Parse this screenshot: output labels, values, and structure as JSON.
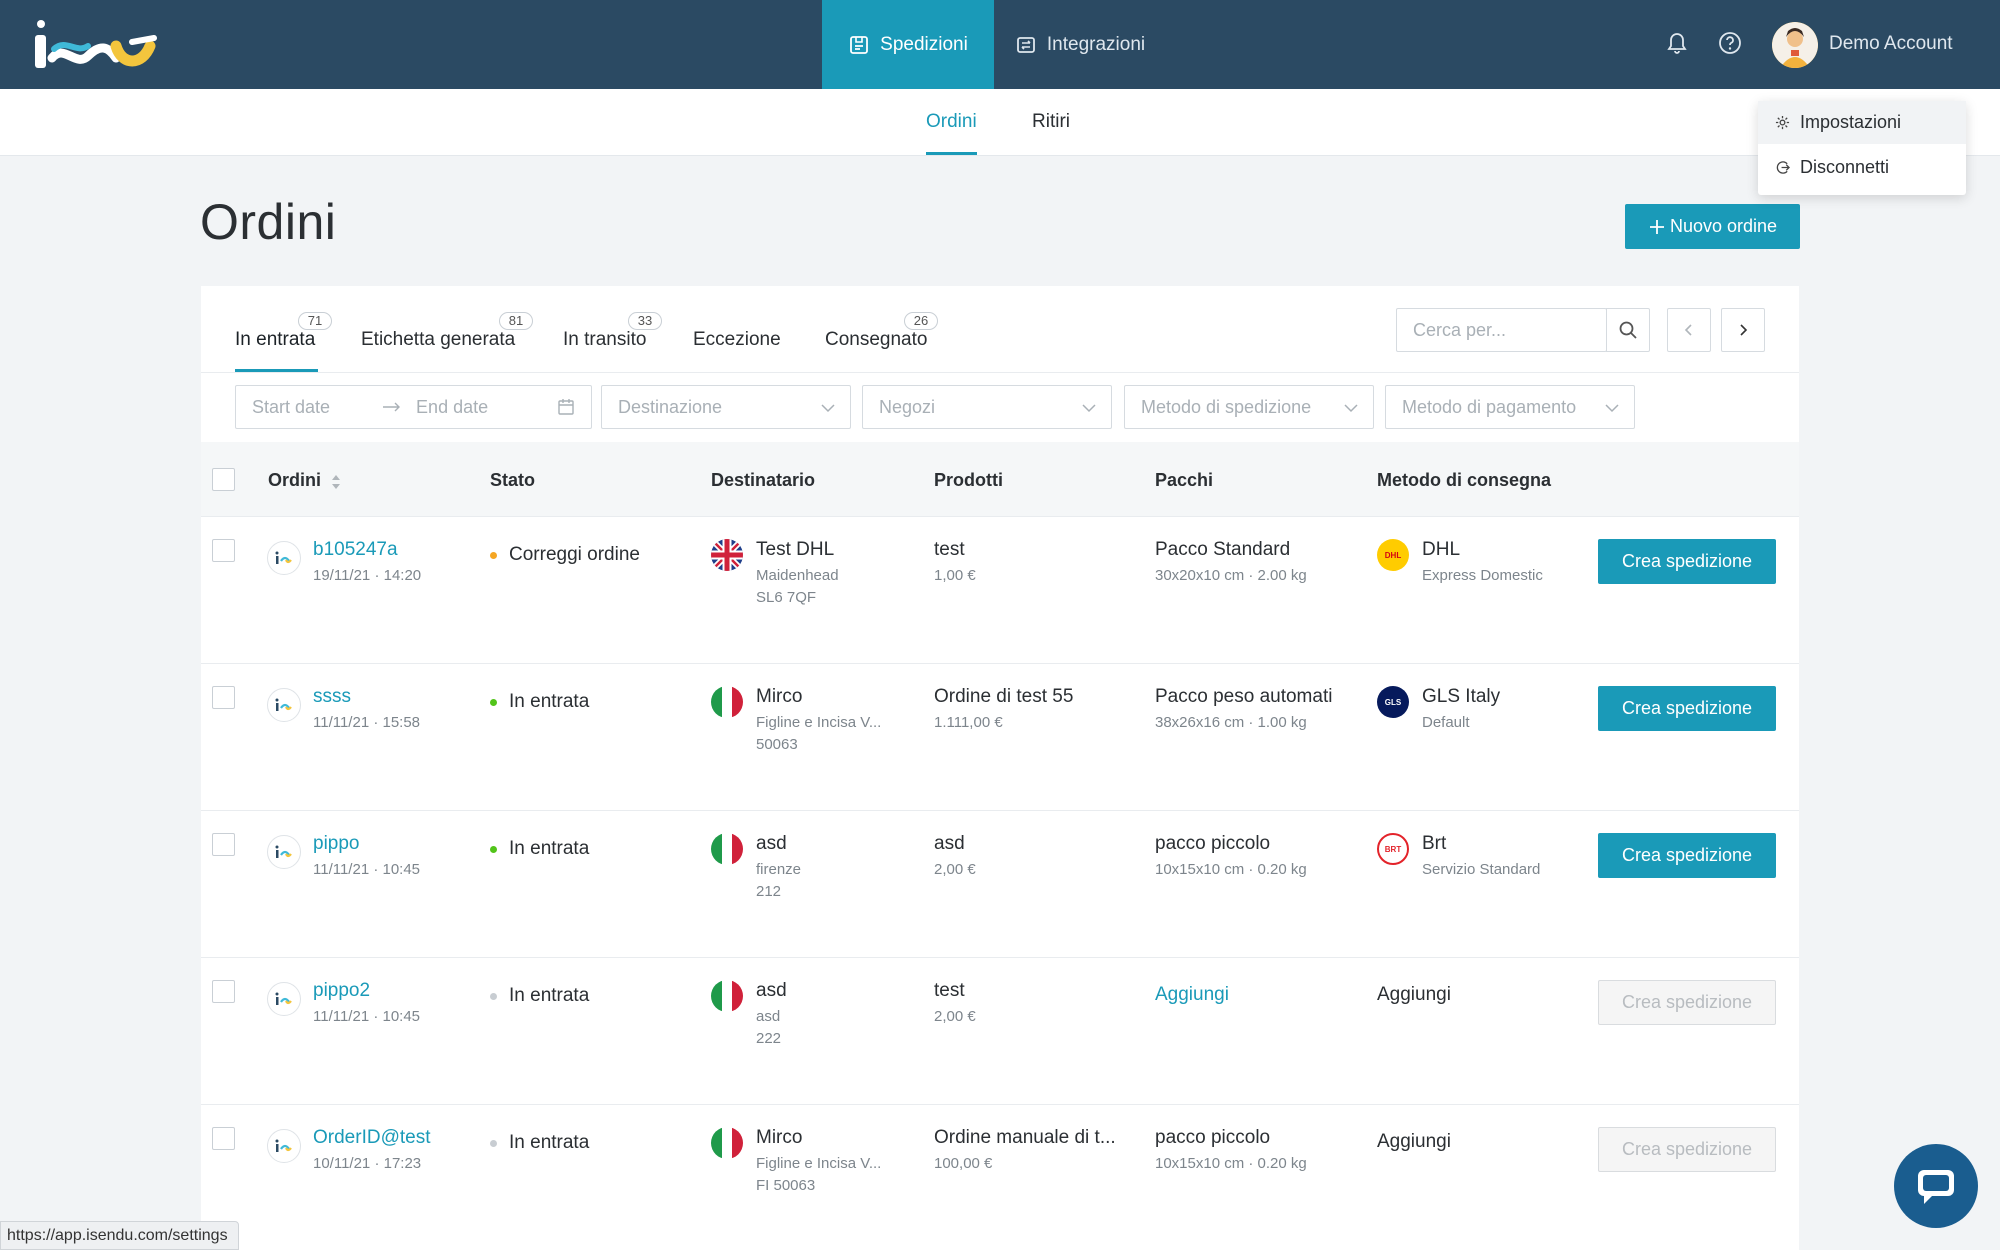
{
  "topbar": {
    "nav": [
      {
        "label": "Spedizioni",
        "icon": "shipment-icon",
        "active": true
      },
      {
        "label": "Integrazioni",
        "icon": "integration-icon",
        "active": false
      }
    ],
    "account_name": "Demo Account"
  },
  "subnav": {
    "tabs": [
      {
        "label": "Ordini",
        "active": true
      },
      {
        "label": "Ritiri",
        "active": false
      }
    ]
  },
  "user_menu": {
    "items": [
      {
        "label": "Impostazioni",
        "icon": "gear-icon"
      },
      {
        "label": "Disconnetti",
        "icon": "logout-icon"
      }
    ]
  },
  "page": {
    "title": "Ordini",
    "new_order_label": "Nuovo ordine"
  },
  "status_tabs": [
    {
      "label": "In entrata",
      "count": "71",
      "active": true
    },
    {
      "label": "Etichetta generata",
      "count": "81",
      "active": false
    },
    {
      "label": "In transito",
      "count": "33",
      "active": false
    },
    {
      "label": "Eccezione",
      "count": "",
      "active": false
    },
    {
      "label": "Consegnato",
      "count": "26",
      "active": false
    }
  ],
  "search": {
    "placeholder": "Cerca per..."
  },
  "filters": {
    "start_date": "Start date",
    "end_date": "End date",
    "destinazione": "Destinazione",
    "negozi": "Negozi",
    "metodo_spedizione": "Metodo di spedizione",
    "metodo_pagamento": "Metodo di pagamento"
  },
  "table": {
    "headers": [
      "Ordini",
      "Stato",
      "Destinatario",
      "Prodotti",
      "Pacchi",
      "Metodo di consegna"
    ],
    "rows": [
      {
        "order_id": "b105247a",
        "date": "19/11/21 · 14:20",
        "status": "Correggi ordine",
        "status_color": "#f5a623",
        "flag": "uk",
        "recipient": "Test DHL",
        "rec_line1": "Maidenhead",
        "rec_line2": "SL6 7QF",
        "product": "test",
        "price": "1,00 €",
        "package": "Pacco Standard",
        "package_dim": "30x20x10 cm · 2.00 kg",
        "carrier": "DHL",
        "carrier_service": "Express Domestic",
        "carrier_logo": "dhl",
        "action": "Crea spedizione",
        "action_enabled": true
      },
      {
        "order_id": "ssss",
        "date": "11/11/21 · 15:58",
        "status": "In entrata",
        "status_color": "#52c41a",
        "flag": "it",
        "recipient": "Mirco",
        "rec_line1": "Figline e Incisa V...",
        "rec_line2": "50063",
        "product": "Ordine di test 55",
        "price": "1.111,00 €",
        "package": "Pacco peso automatico",
        "package_dim": "38x26x16 cm · 1.00 kg",
        "carrier": "GLS Italy",
        "carrier_service": "Default",
        "carrier_logo": "gls",
        "action": "Crea spedizione",
        "action_enabled": true
      },
      {
        "order_id": "pippo",
        "date": "11/11/21 · 10:45",
        "status": "In entrata",
        "status_color": "#52c41a",
        "flag": "it",
        "recipient": "asd",
        "rec_line1": "firenze",
        "rec_line2": "212",
        "product": "asd",
        "price": "2,00 €",
        "package": "pacco piccolo",
        "package_dim": "10x15x10 cm · 0.20 kg",
        "carrier": "Brt",
        "carrier_service": "Servizio Standard",
        "carrier_logo": "brt",
        "action": "Crea spedizione",
        "action_enabled": true
      },
      {
        "order_id": "pippo2",
        "date": "11/11/21 · 10:45",
        "status": "In entrata",
        "status_color": "#c8cdd2",
        "flag": "it",
        "recipient": "asd",
        "rec_line1": "asd",
        "rec_line2": "222",
        "product": "test",
        "price": "2,00 €",
        "package_link": "Aggiungi",
        "carrier_link": "Aggiungi",
        "action": "Crea spedizione",
        "action_enabled": false
      },
      {
        "order_id": "OrderID@test",
        "date": "10/11/21 · 17:23",
        "status": "In entrata",
        "status_color": "#c8cdd2",
        "flag": "it",
        "recipient": "Mirco",
        "rec_line1": "Figline e Incisa V...",
        "rec_line2": "FI 50063",
        "product": "Ordine manuale di t...",
        "price": "100,00 €",
        "package": "pacco piccolo",
        "package_dim": "10x15x10 cm · 0.20 kg",
        "carrier_link": "Aggiungi",
        "action": "Crea spedizione",
        "action_enabled": false
      }
    ]
  },
  "statusbar": {
    "url": "https://app.isendu.com/settings"
  },
  "colors": {
    "topbar": "#2b4a63",
    "accent": "#1a9ab8"
  }
}
